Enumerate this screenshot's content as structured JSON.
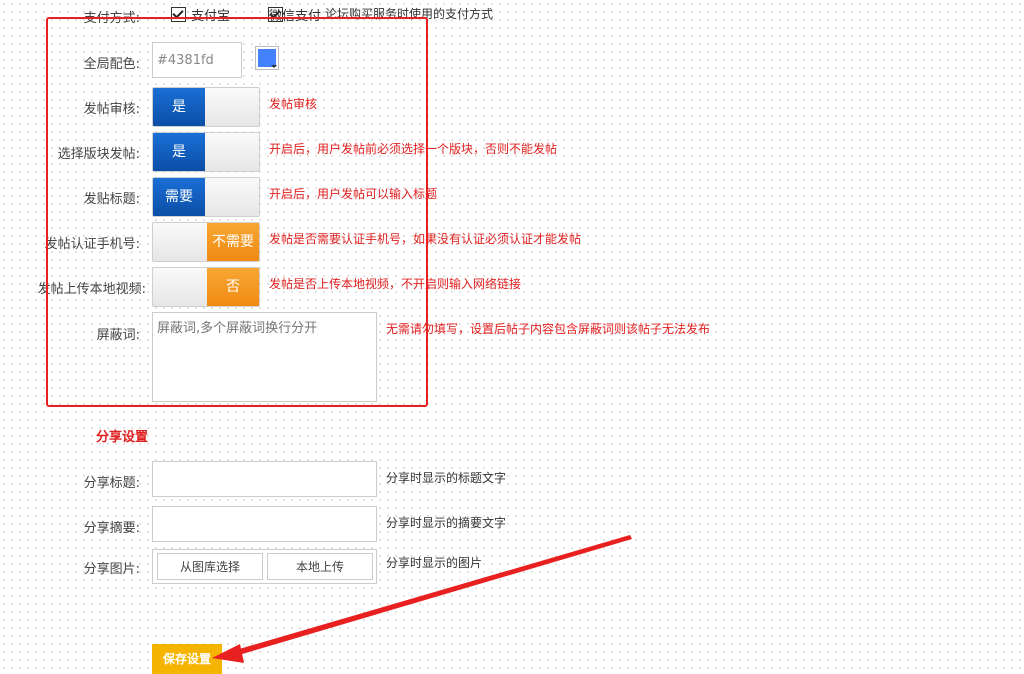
{
  "payment": {
    "label": "支付方式:",
    "options": [
      {
        "label": "支付宝",
        "checked": true
      },
      {
        "label": "微信支付",
        "checked": true
      }
    ],
    "hint": "论坛购买服务时使用的支付方式"
  },
  "color": {
    "label": "全局配色:",
    "value": "#4381fd",
    "swatch": "#4381fd"
  },
  "review": {
    "label": "发帖审核:",
    "state": "是",
    "hint": "发帖审核"
  },
  "choose_board": {
    "label": "选择版块发帖:",
    "state": "是",
    "hint": "开启后，用户发帖前必须选择一个版块，否则不能发帖"
  },
  "post_title": {
    "label": "发贴标题:",
    "state": "需要",
    "hint": "开启后，用户发帖可以输入标题"
  },
  "phone_verify": {
    "label": "发帖认证手机号:",
    "state": "不需要",
    "hint": "发帖是否需要认证手机号，如果没有认证必须认证才能发帖"
  },
  "local_video": {
    "label": "发帖上传本地视频:",
    "state": "否",
    "hint": "发帖是否上传本地视频，不开启则输入网络链接"
  },
  "block_words": {
    "label": "屏蔽词:",
    "placeholder": "屏蔽词,多个屏蔽词换行分开",
    "hint": "无需请勿填写，设置后帖子内容包含屏蔽词则该帖子无法发布"
  },
  "share": {
    "section_title": "分享设置",
    "title_label": "分享标题:",
    "title_hint": "分享时显示的标题文字",
    "summary_label": "分享摘要:",
    "summary_hint": "分享时显示的摘要文字",
    "image_label": "分享图片:",
    "image_btn_library": "从图库选择",
    "image_btn_local": "本地上传",
    "image_hint": "分享时显示的图片"
  },
  "save_label": "保存设置",
  "colors": {
    "annotation": "#e8201f",
    "toggle_on": "#0b4ea6",
    "toggle_off": "#f08a12",
    "save": "#f5b400"
  }
}
